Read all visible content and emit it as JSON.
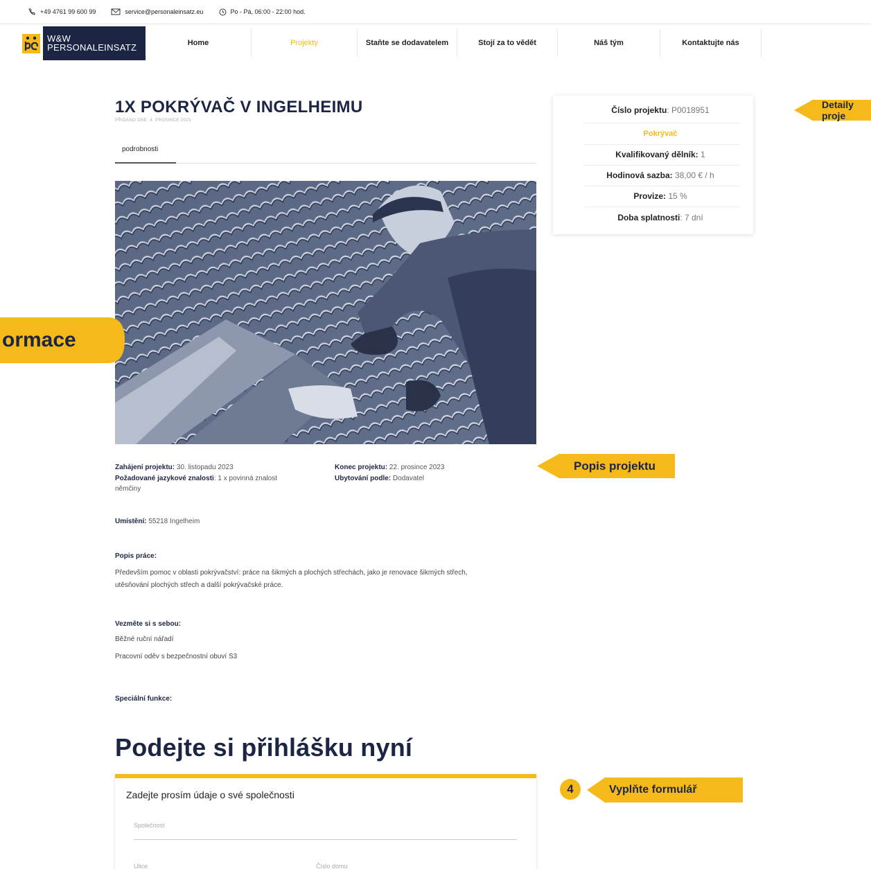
{
  "topbar": {
    "phone": "+49 4761 99 600 99",
    "email": "service@personaleinsatz.eu",
    "hours": "Po - Pá, 06:00 - 22:00 hod."
  },
  "logo": {
    "line1": "W&W",
    "line2": "PERSONALEINSATZ"
  },
  "nav": {
    "items": [
      {
        "label": "Home"
      },
      {
        "label": "Projekty"
      },
      {
        "label": "Staňte se dodavatelem"
      },
      {
        "label": "Stojí za to vědět"
      },
      {
        "label": "Náš tým"
      },
      {
        "label": "Kontaktujte nás"
      }
    ],
    "active": "Projekty"
  },
  "project": {
    "title": "1X POKRÝVAČ V INGELHEIMU",
    "added": "PŘIDÁNO DNE: 4. PROSINCE 2023",
    "tab": "podrobnosti",
    "start_label": "Zahájení projektu:",
    "start_value": "30. listopadu 2023",
    "end_label": "Konec projektu:",
    "end_value": "22. prosince 2023",
    "lang_label": "Požadované jazykové znalosti",
    "lang_value": ": 1 x povinná znalost",
    "lang_value2": "němčiny",
    "accommodation_label": "Ubytování podle:",
    "accommodation_value": "Dodavatel",
    "location_label": "Umístění:",
    "location_value": "55218 Ingelheim",
    "work_heading": "Popis práce:",
    "work_text1": "Především pomoc v oblasti pokrývačství: práce na šikmých a plochých střechách, jako je renovace šikmých střech,",
    "work_text2": "utěsňování plochých střech a další pokrývačské práce.",
    "bring_heading": "Vezměte si s sebou:",
    "bring_items": [
      "Běžné ruční nářadí",
      "Pracovní oděv s bezpečnostní obuví S3"
    ],
    "special_heading": "Speciální funkce:"
  },
  "apply": {
    "heading": "Podejte si přihlášku nyní",
    "form_title": "Zadejte prosím údaje o své společnosti",
    "company_placeholder": "Společnost",
    "street_placeholder": "Ulice",
    "house_placeholder": "Číslo domu"
  },
  "details": {
    "number_label": "Číslo projektu",
    "number_value": ": P0018951",
    "category": "Pokrývač",
    "workers_label": "Kvalifikovaný dělník:",
    "workers_value": " 1",
    "rate_label": "Hodinová sazba:",
    "rate_value": " 38,00 € / h",
    "commission_label": "Provize:",
    "commission_value": " 15 %",
    "due_label": "Doba splatnosti",
    "due_value": ": 7 dní"
  },
  "callouts": {
    "details": "Detaily proje",
    "info": "ormace",
    "description": "Popis projektu",
    "form_number": "4",
    "form": "Vyplňte formulář"
  },
  "colors": {
    "accent": "#f6b91a",
    "navy": "#1c2544"
  }
}
